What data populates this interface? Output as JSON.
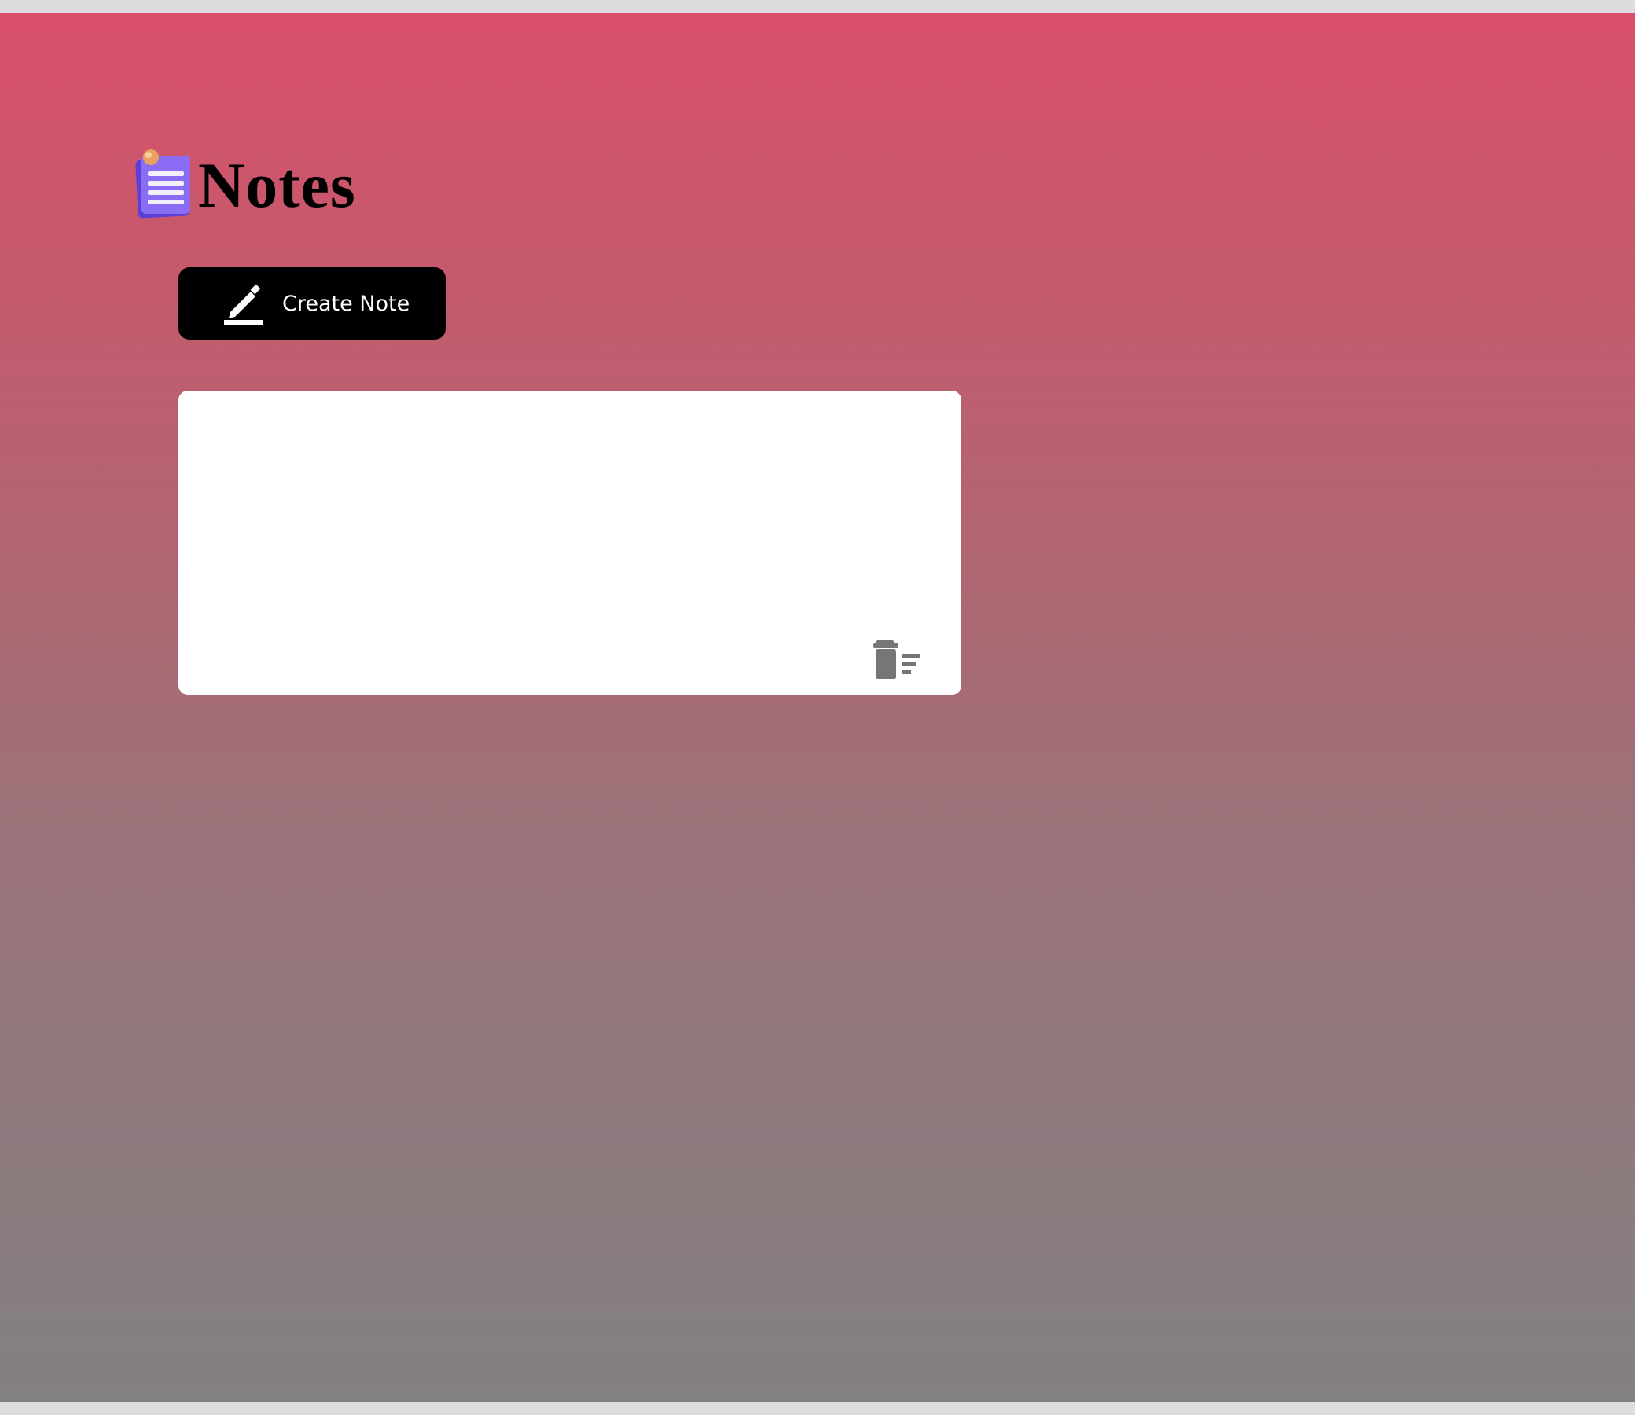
{
  "app": {
    "title": "Notes",
    "logo_icon": "notepad-icon"
  },
  "toolbar": {
    "create_label": "Create Note",
    "create_icon": "pencil-icon"
  },
  "notes": [
    {
      "content": "",
      "delete_icon": "trash-icon"
    }
  ],
  "colors": {
    "background_top": "#d9506a",
    "background_bottom": "#838181",
    "button_bg": "#000000",
    "button_text": "#ffffff",
    "card_bg": "#ffffff",
    "logo_purple": "#7b5cf0",
    "trash_gray": "#767676"
  }
}
